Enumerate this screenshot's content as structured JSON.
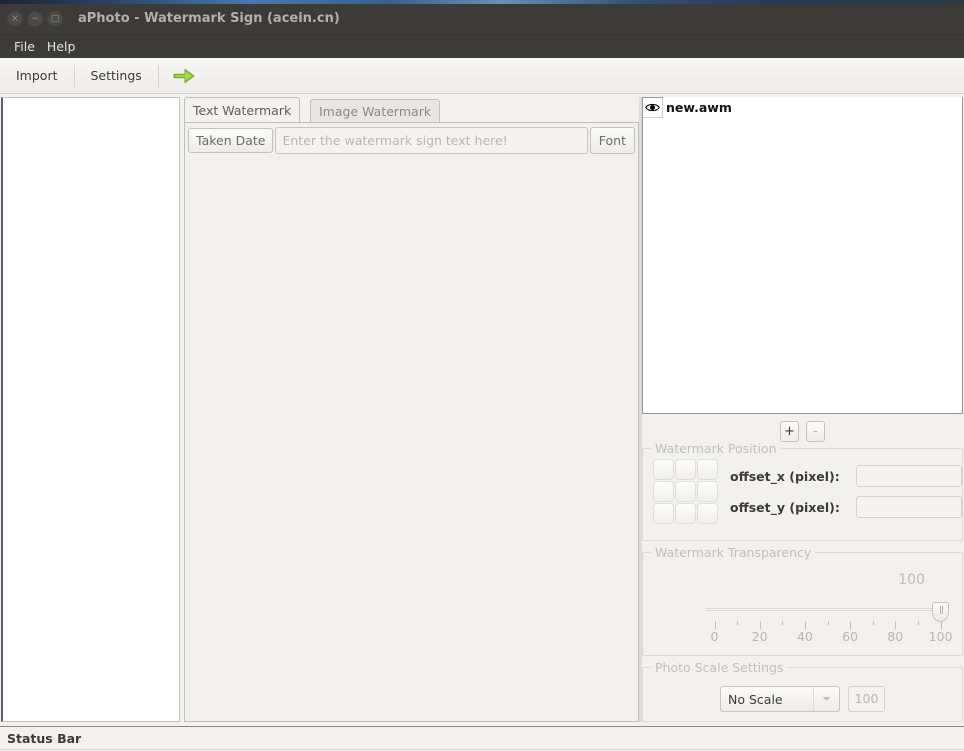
{
  "window": {
    "title": "aPhoto - Watermark Sign (acein.cn)",
    "controls": [
      {
        "name": "close",
        "glyph": "×"
      },
      {
        "name": "minimize",
        "glyph": "−"
      },
      {
        "name": "maximize",
        "glyph": "□"
      }
    ]
  },
  "menu": {
    "items": [
      {
        "label": "File"
      },
      {
        "label": "Help"
      }
    ]
  },
  "toolbar": {
    "import_label": "Import",
    "settings_label": "Settings",
    "go_icon": "green-right-arrow-icon",
    "go_color": "#8cc63f"
  },
  "tabs": [
    {
      "label": "Text Watermark",
      "active": true
    },
    {
      "label": "Image Watermark",
      "active": false
    }
  ],
  "text_watermark": {
    "taken_date_label": "Taken Date",
    "input_value": "",
    "input_placeholder": "Enter the watermark sign text here!",
    "font_label": "Font"
  },
  "watermark_list": {
    "visibility_icon": "eye-icon",
    "items": [
      {
        "name": "new.awm"
      }
    ],
    "add_label": "+",
    "remove_label": "-",
    "remove_enabled": false
  },
  "position_group": {
    "title": "Watermark Position",
    "grid_cells": 9,
    "offset_x_label": "offset_x (pixel):",
    "offset_x_value": "",
    "offset_y_label": "offset_y (pixel):",
    "offset_y_value": ""
  },
  "transparency_group": {
    "title": "Watermark Transparency",
    "value": "100",
    "min": 0,
    "max": 100,
    "tick_labels": [
      "0",
      "20",
      "40",
      "60",
      "80",
      "100"
    ],
    "tick_values": [
      0,
      20,
      40,
      60,
      80,
      100
    ],
    "minor_tick_values": [
      10,
      30,
      50,
      70,
      90
    ]
  },
  "scale_group": {
    "title": "Photo Scale Settings",
    "selected_option": "No Scale",
    "options": [
      "No Scale"
    ],
    "scale_value": "100",
    "scale_value_enabled": false
  },
  "status_bar": {
    "text": "Status Bar"
  }
}
